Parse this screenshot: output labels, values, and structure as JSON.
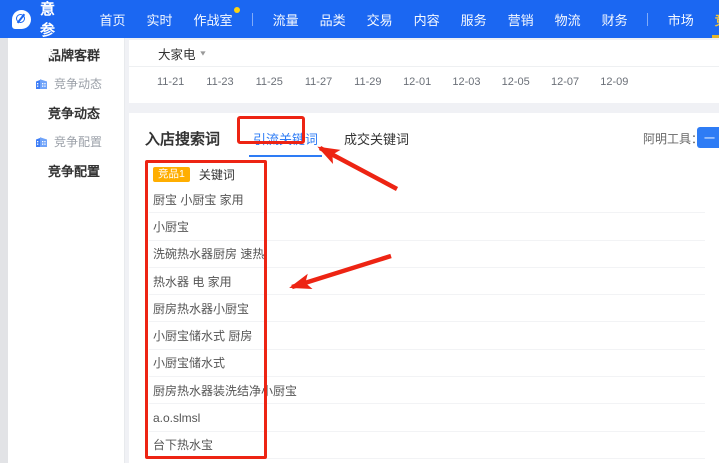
{
  "navbar": {
    "logo_text": "生意参谋",
    "items": [
      {
        "label": "首页"
      },
      {
        "label": "实时"
      },
      {
        "label": "作战室"
      },
      {
        "label": "流量"
      },
      {
        "label": "品类"
      },
      {
        "label": "交易"
      },
      {
        "label": "内容"
      },
      {
        "label": "服务"
      },
      {
        "label": "营销"
      },
      {
        "label": "物流"
      },
      {
        "label": "财务"
      },
      {
        "label": "市场"
      },
      {
        "label": "竞争"
      }
    ],
    "active_item": "竞争"
  },
  "sidebar": {
    "items": [
      {
        "label": "品牌客群",
        "type": "header"
      },
      {
        "label": "竞争动态",
        "type": "link",
        "icon": "building-icon"
      },
      {
        "label": "竞争动态",
        "type": "header"
      },
      {
        "label": "竞争配置",
        "type": "link",
        "icon": "building-icon"
      },
      {
        "label": "竞争配置",
        "type": "header"
      }
    ]
  },
  "filter_card": {
    "category_dropdown": "大家电",
    "dates": [
      "11-21",
      "11-23",
      "11-25",
      "11-27",
      "11-29",
      "12-01",
      "12-03",
      "12-05",
      "12-07",
      "12-09"
    ]
  },
  "search_words_section": {
    "title": "入店搜索词",
    "tabs": [
      {
        "label": "引流关键词",
        "active": true
      },
      {
        "label": "成交关键词",
        "active": false
      }
    ],
    "tool_label": "阿明工具：",
    "tool_button_visible_text": "一",
    "table": {
      "competitor_badge": "竞品1",
      "column_header": "关键词",
      "keywords": [
        "厨宝 小厨宝 家用",
        "小厨宝",
        "洗碗热水器厨房 速热",
        "热水器 电 家用",
        "厨房热水器小厨宝",
        "小厨宝储水式 厨房",
        "小厨宝储水式",
        "厨房热水器装洗结净小厨宝",
        "a.o.slmsl",
        "台下热水宝"
      ]
    }
  },
  "colors": {
    "navbar_blue": "#1b67f2",
    "active_yellow": "#f0c53d",
    "badge_orange": "#ffae00",
    "link_blue": "#2e7cf5",
    "annotation_red": "#ed2413"
  }
}
